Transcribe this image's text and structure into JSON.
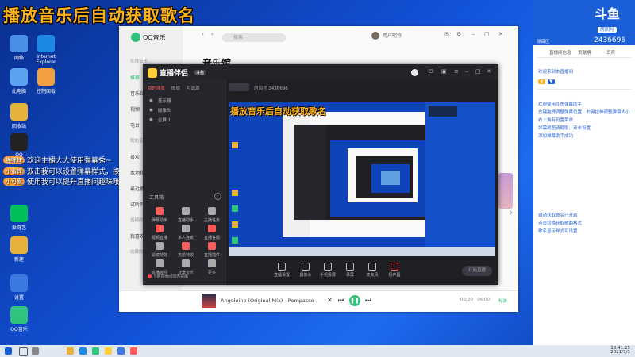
{
  "overlay_title": "播放音乐后自动获取歌名",
  "desktop_icons": [
    {
      "name": "network-icon",
      "label": "网络",
      "color": "#4a8fe7"
    },
    {
      "name": "ie-icon",
      "label": "Internet Explorer",
      "color": "#1e88e5"
    },
    {
      "name": "computer-icon",
      "label": "此电脑",
      "color": "#5aa3f0"
    },
    {
      "name": "app-icon",
      "label": "控制面板",
      "color": "#f0a040"
    },
    {
      "name": "folder-icon",
      "label": "回收站",
      "color": "#e8b23a"
    },
    {
      "name": "qq-icon",
      "label": "QQ",
      "color": "#222"
    },
    {
      "name": "iqiyi-icon",
      "label": "爱奇艺",
      "color": "#00c05a"
    },
    {
      "name": "file-icon",
      "label": "新建",
      "color": "#e8b23a"
    },
    {
      "name": "settings-icon",
      "label": "设置",
      "color": "#3b7ae0"
    },
    {
      "name": "qqmusic-icon",
      "label": "QQ音乐",
      "color": "#31c27c"
    }
  ],
  "danmu": [
    {
      "user": "猫咪妹",
      "text": "欢迎主播大大使用弹幕秀~"
    },
    {
      "user": "小蜜蜂",
      "text": "双击我可以设置弹幕样式，换颜色哦~"
    },
    {
      "user": "小可爱",
      "text": "使用我可以提升直播间趣味哦~"
    }
  ],
  "qq_music": {
    "logo": "QQ音乐",
    "search_placeholder": "搜索",
    "page_title": "音乐馆",
    "nav": [
      "在线音乐",
      "推荐",
      "音乐馆",
      "视频",
      "电台",
      "我的音乐",
      "喜欢",
      "本地和下载",
      "最近播放",
      "试听列表",
      "创建的歌单",
      "我喜欢",
      "收藏的歌单"
    ],
    "user": "用户昵称",
    "song": "Angeleine (Original Mix) - Pompasso",
    "time": "00:20 / 06:00",
    "quality": "标准"
  },
  "zhibo": {
    "app_name": "直播伴侣",
    "tag": "斗鱼",
    "tabs": [
      "我的场景",
      "图层",
      "可选源"
    ],
    "active_tab": "我的场景",
    "sources": [
      "显示器",
      "摄像头",
      "全屏 1"
    ],
    "room_label": "房间号 2436696",
    "tools_title": "工具箱",
    "tools": [
      "弹幕助手",
      "直播助手",
      "主播任务",
      "视频直播",
      "多人连麦",
      "直播答题",
      "滤镜特效",
      "美颜特效",
      "直播插件",
      "直播房间",
      "背景音乐",
      "更多"
    ],
    "notice": "5条直播间动态提醒",
    "bottom": [
      "直播设置",
      "摄像头",
      "手机投屏",
      "录屏",
      "麦克风",
      "扬声器"
    ],
    "start": "开始直播",
    "preview_title": "播放音乐后自动获取歌名"
  },
  "right_panel": {
    "logo": "斗鱼",
    "logo_sub": "房间号",
    "room_number": "2436696",
    "caption": "弹幕区",
    "info": [
      "直播间信息",
      "贡献榜",
      "贵宾"
    ],
    "welcome": "欢迎来到本直播间",
    "messages": [
      "欢迎使用斗鱼弹幕助手",
      "左键拖拽调整弹幕位置，右键拉伸调整弹幕大小",
      "右上角有设置菜单",
      "如需截图请截取，双击设置",
      "添加弹幕助手成功"
    ],
    "messages2": [
      "自动获取歌名已开启",
      "点击切换获取歌曲格式",
      "歌名显示样式可设置"
    ]
  },
  "taskbar": {
    "time": "18:41:25",
    "date": "2021/7/1"
  },
  "colors": {
    "accent": "#31c27c",
    "overlay": "#ffb11a",
    "douyu": "#1a5fd8"
  }
}
